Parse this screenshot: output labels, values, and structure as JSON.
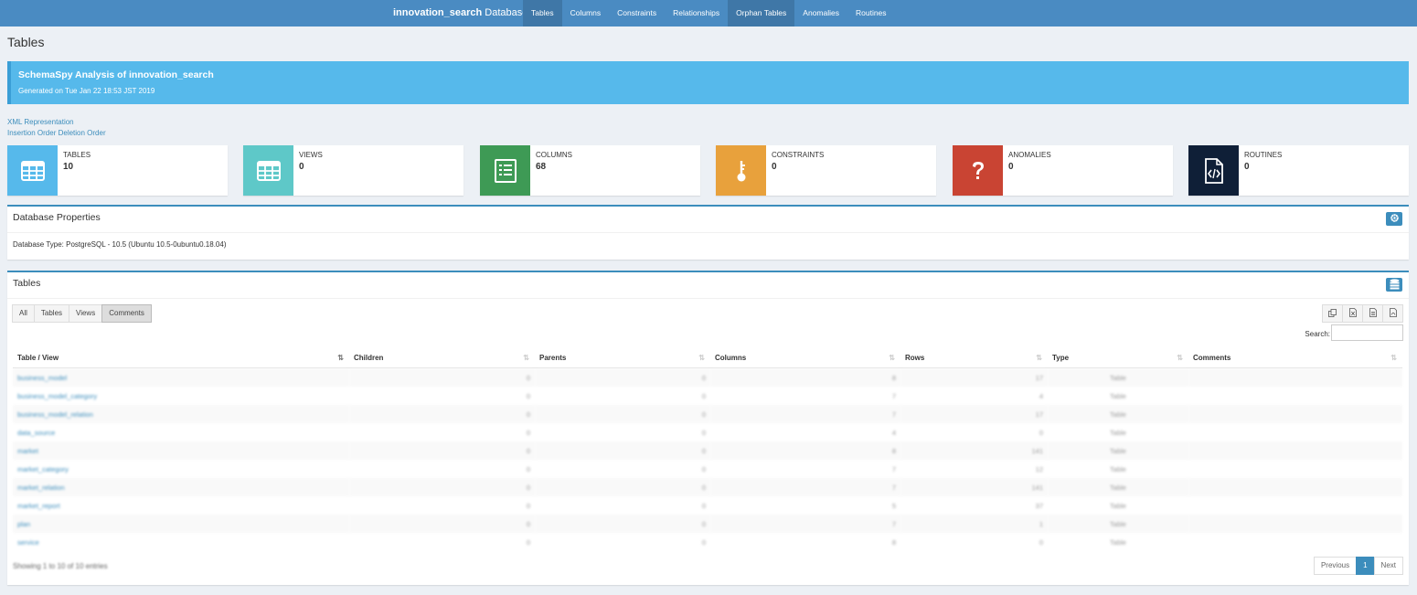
{
  "nav": {
    "brand_name": "innovation_search",
    "brand_suffix": "Database",
    "items": [
      "Tables",
      "Columns",
      "Constraints",
      "Relationships",
      "Orphan Tables",
      "Anomalies",
      "Routines"
    ]
  },
  "page": {
    "title": "Tables"
  },
  "callout": {
    "heading": "SchemaSpy Analysis of innovation_search",
    "subtitle": "Generated on Tue Jan 22 18:53 JST 2019"
  },
  "links": {
    "xml": "XML Representation",
    "insertion": "Insertion Order",
    "deletion": "Deletion Order"
  },
  "stats": [
    {
      "label": "Tables",
      "value": "10",
      "color": "#56b9eb",
      "icon": "table-icon"
    },
    {
      "label": "Views",
      "value": "0",
      "color": "#5ec8c8",
      "icon": "table-icon"
    },
    {
      "label": "Columns",
      "value": "68",
      "color": "#3e9a55",
      "icon": "list-icon"
    },
    {
      "label": "Constraints",
      "value": "0",
      "color": "#e8a13c",
      "icon": "key-icon"
    },
    {
      "label": "Anomalies",
      "value": "0",
      "color": "#c94433",
      "icon": "question-icon"
    },
    {
      "label": "Routines",
      "value": "0",
      "color": "#0f1f37",
      "icon": "code-file-icon"
    }
  ],
  "db_props": {
    "title": "Database Properties",
    "type_text": "Database Type: PostgreSQL - 10.5 (Ubuntu 10.5-0ubuntu0.18.04)"
  },
  "tables_panel": {
    "title": "Tables",
    "filters": [
      "All",
      "Tables",
      "Views",
      "Comments"
    ],
    "search_label": "Search:",
    "columns": [
      "Table / View",
      "Children",
      "Parents",
      "Columns",
      "Rows",
      "Type",
      "Comments"
    ],
    "rows": [
      [
        "business_model",
        "0",
        "0",
        "8",
        "17",
        "Table",
        ""
      ],
      [
        "business_model_category",
        "0",
        "0",
        "7",
        "4",
        "Table",
        ""
      ],
      [
        "business_model_relation",
        "0",
        "0",
        "7",
        "17",
        "Table",
        ""
      ],
      [
        "data_source",
        "0",
        "0",
        "4",
        "0",
        "Table",
        ""
      ],
      [
        "market",
        "0",
        "0",
        "8",
        "141",
        "Table",
        ""
      ],
      [
        "market_category",
        "0",
        "0",
        "7",
        "12",
        "Table",
        ""
      ],
      [
        "market_relation",
        "0",
        "0",
        "7",
        "141",
        "Table",
        ""
      ],
      [
        "market_report",
        "0",
        "0",
        "5",
        "37",
        "Table",
        ""
      ],
      [
        "plan",
        "0",
        "0",
        "7",
        "1",
        "Table",
        ""
      ],
      [
        "service",
        "0",
        "0",
        "8",
        "0",
        "Table",
        ""
      ]
    ],
    "info": "Showing 1 to 10 of 10 entries",
    "pager": {
      "prev": "Previous",
      "current": "1",
      "next": "Next"
    }
  }
}
